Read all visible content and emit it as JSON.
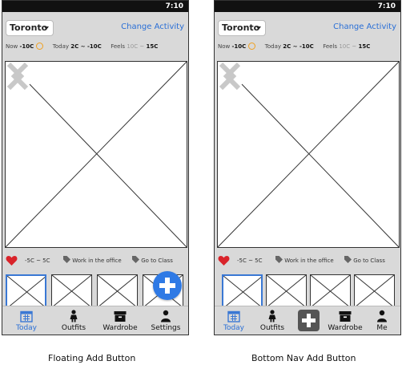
{
  "status": {
    "time": "7:10"
  },
  "header": {
    "city": "Toronto",
    "change_activity": "Change Activity"
  },
  "weather": {
    "now_label": "Now",
    "now_value": "-10C",
    "today_label": "Today",
    "today_value": "2C ~ -10C",
    "feels_label": "Feels",
    "feels_value_start": "10C ~ ",
    "feels_value_end": "15C"
  },
  "outfit": {
    "temp_range": "-5C ~ 5C",
    "tags": [
      "Work in the office",
      "Go to Class"
    ]
  },
  "variant_a": {
    "caption": "Floating Add Button",
    "nav": [
      "Today",
      "Outfits",
      "Wardrobe",
      "Settings"
    ]
  },
  "variant_b": {
    "caption": "Bottom Nav Add Button",
    "nav": [
      "Today",
      "Outfits",
      "Wardrobe",
      "Me"
    ]
  },
  "colors": {
    "accent": "#2a6fd6",
    "heart": "#d9232a",
    "fab": "#2f7ae5"
  }
}
